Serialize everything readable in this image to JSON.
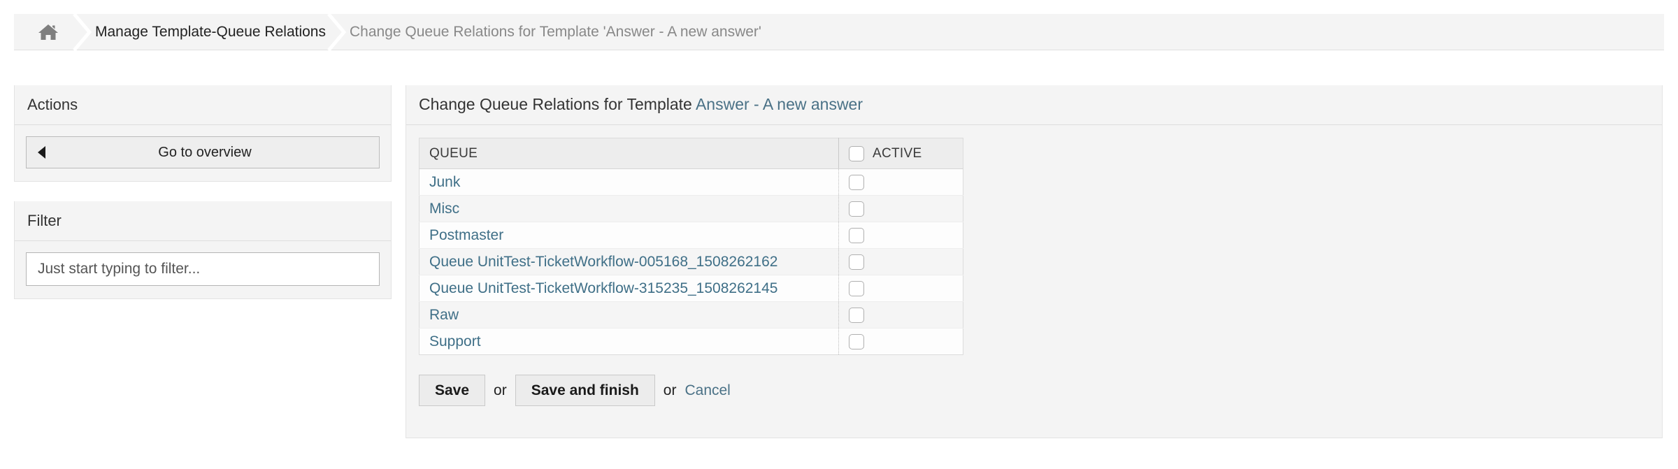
{
  "breadcrumb": {
    "home_icon": "home-icon",
    "items": [
      {
        "label": "Manage Template-Queue Relations",
        "active": true
      },
      {
        "label": "Change Queue Relations for Template 'Answer - A new answer'",
        "active": false
      }
    ]
  },
  "sidebar": {
    "actions": {
      "title": "Actions",
      "overview_button": {
        "label": "Go to overview",
        "icon": "caret-left-icon"
      }
    },
    "filter": {
      "title": "Filter",
      "input_placeholder": "Just start typing to filter...",
      "input_value": ""
    }
  },
  "main": {
    "header_prefix": "Change Queue Relations for Template ",
    "header_link": "Answer - A new answer",
    "table": {
      "columns": [
        "QUEUE",
        "ACTIVE"
      ],
      "select_all_checkbox": {
        "name": "select-all-active-checkbox",
        "checked": false
      },
      "rows": [
        {
          "queue": "Junk",
          "active": false
        },
        {
          "queue": "Misc",
          "active": false
        },
        {
          "queue": "Postmaster",
          "active": false
        },
        {
          "queue": "Queue UnitTest-TicketWorkflow-005168_1508262162",
          "active": false
        },
        {
          "queue": "Queue UnitTest-TicketWorkflow-315235_1508262145",
          "active": false
        },
        {
          "queue": "Raw",
          "active": false
        },
        {
          "queue": "Support",
          "active": false
        }
      ]
    },
    "actions": {
      "save_label": "Save",
      "or_label_1": "or",
      "save_finish_label": "Save and finish",
      "or_label_2": "or",
      "cancel_label": "Cancel"
    }
  },
  "colors": {
    "link": "#3f6f87",
    "page_background": "#ffffff",
    "widget_background": "#f4f4f4",
    "header_text": "#333333",
    "muted_text": "#888888"
  }
}
